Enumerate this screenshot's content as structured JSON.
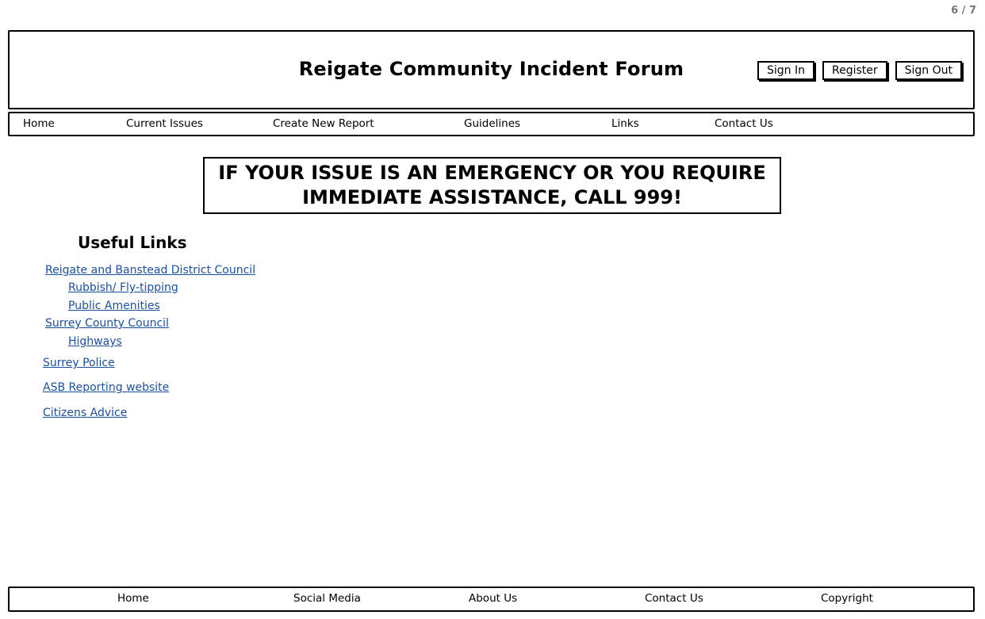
{
  "page_counter": "6 / 7",
  "header": {
    "title": "Reigate Community Incident Forum",
    "buttons": {
      "sign_in": "Sign In",
      "register": "Register",
      "sign_out": "Sign Out"
    }
  },
  "nav": {
    "items": [
      "Home",
      "Current Issues",
      "Create New Report",
      "Guidelines",
      "Links",
      "Contact Us"
    ]
  },
  "emergency": {
    "line1": "IF YOUR ISSUE IS AN EMERGENCY OR YOU REQUIRE",
    "line2": "IMMEDIATE ASSISTANCE, CALL 999!"
  },
  "useful_links": {
    "heading": "Useful Links",
    "links": [
      "Reigate and Banstead District Council",
      "Rubbish/ Fly-tipping",
      "Public Amenities",
      "Surrey County Council",
      "Highways",
      "Surrey Police",
      "ASB Reporting website",
      "Citizens Advice"
    ]
  },
  "footer": {
    "items": [
      "Home",
      "Social Media",
      "About Us",
      "Contact Us",
      "Copyright"
    ]
  },
  "colors": {
    "link": "#1c4f9c",
    "border": "#000000",
    "page_counter": "#777777"
  }
}
